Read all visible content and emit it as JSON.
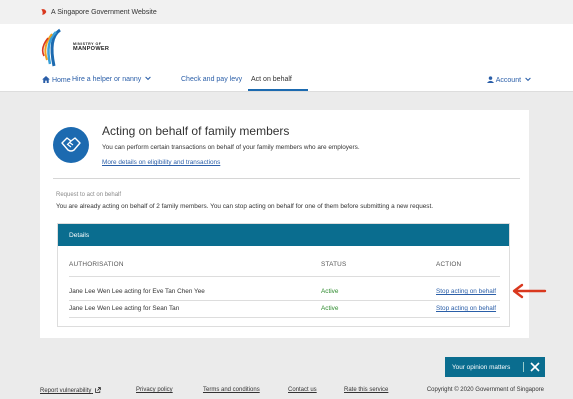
{
  "gov_banner": {
    "text": "A Singapore Government Website",
    "icon": "lion-head-icon"
  },
  "logo": {
    "line1": "MINISTRY OF",
    "line2": "MANPOWER"
  },
  "nav": {
    "items": [
      {
        "label": "Home",
        "icon": "home-icon"
      },
      {
        "label": "Hire a helper or nanny",
        "icon": "chevron-down-icon"
      },
      {
        "label": "Check and pay levy"
      },
      {
        "label": "Act on behalf",
        "active": true
      }
    ],
    "account_label": "Account"
  },
  "hero": {
    "title": "Acting on behalf of family members",
    "description": "You can perform certain transactions on behalf of your family members who are employers.",
    "link": "More details on eligibility and transactions"
  },
  "request": {
    "label": "Request to act on behalf",
    "text": "You are already acting on behalf of 2 family members. You can stop acting on behalf for one of them before submitting a new request."
  },
  "details": {
    "title": "Details",
    "columns": [
      "AUTHORISATION",
      "STATUS",
      "ACTION"
    ],
    "rows": [
      {
        "authorisation": "Jane Lee Wen Lee acting for Eve Tan Chen Yee",
        "status": "Active",
        "action": "Stop acting on behalf"
      },
      {
        "authorisation": "Jane Lee Wen Lee acting for Sean Tan",
        "status": "Active",
        "action": "Stop acting on behalf"
      }
    ]
  },
  "feedback": {
    "label": "Your opinion matters"
  },
  "footer": {
    "links": [
      "Report vulnerability",
      "Privacy policy",
      "Terms and conditions",
      "Contact us",
      "Rate this service"
    ],
    "copyright": "Copyright © 2020 Government of Singapore"
  },
  "colors": {
    "primary": "#1c6ab0",
    "table_header": "#0a6d8f",
    "active": "#2e8b2e",
    "arrow": "#d9381e",
    "link": "#2a5ea8"
  }
}
